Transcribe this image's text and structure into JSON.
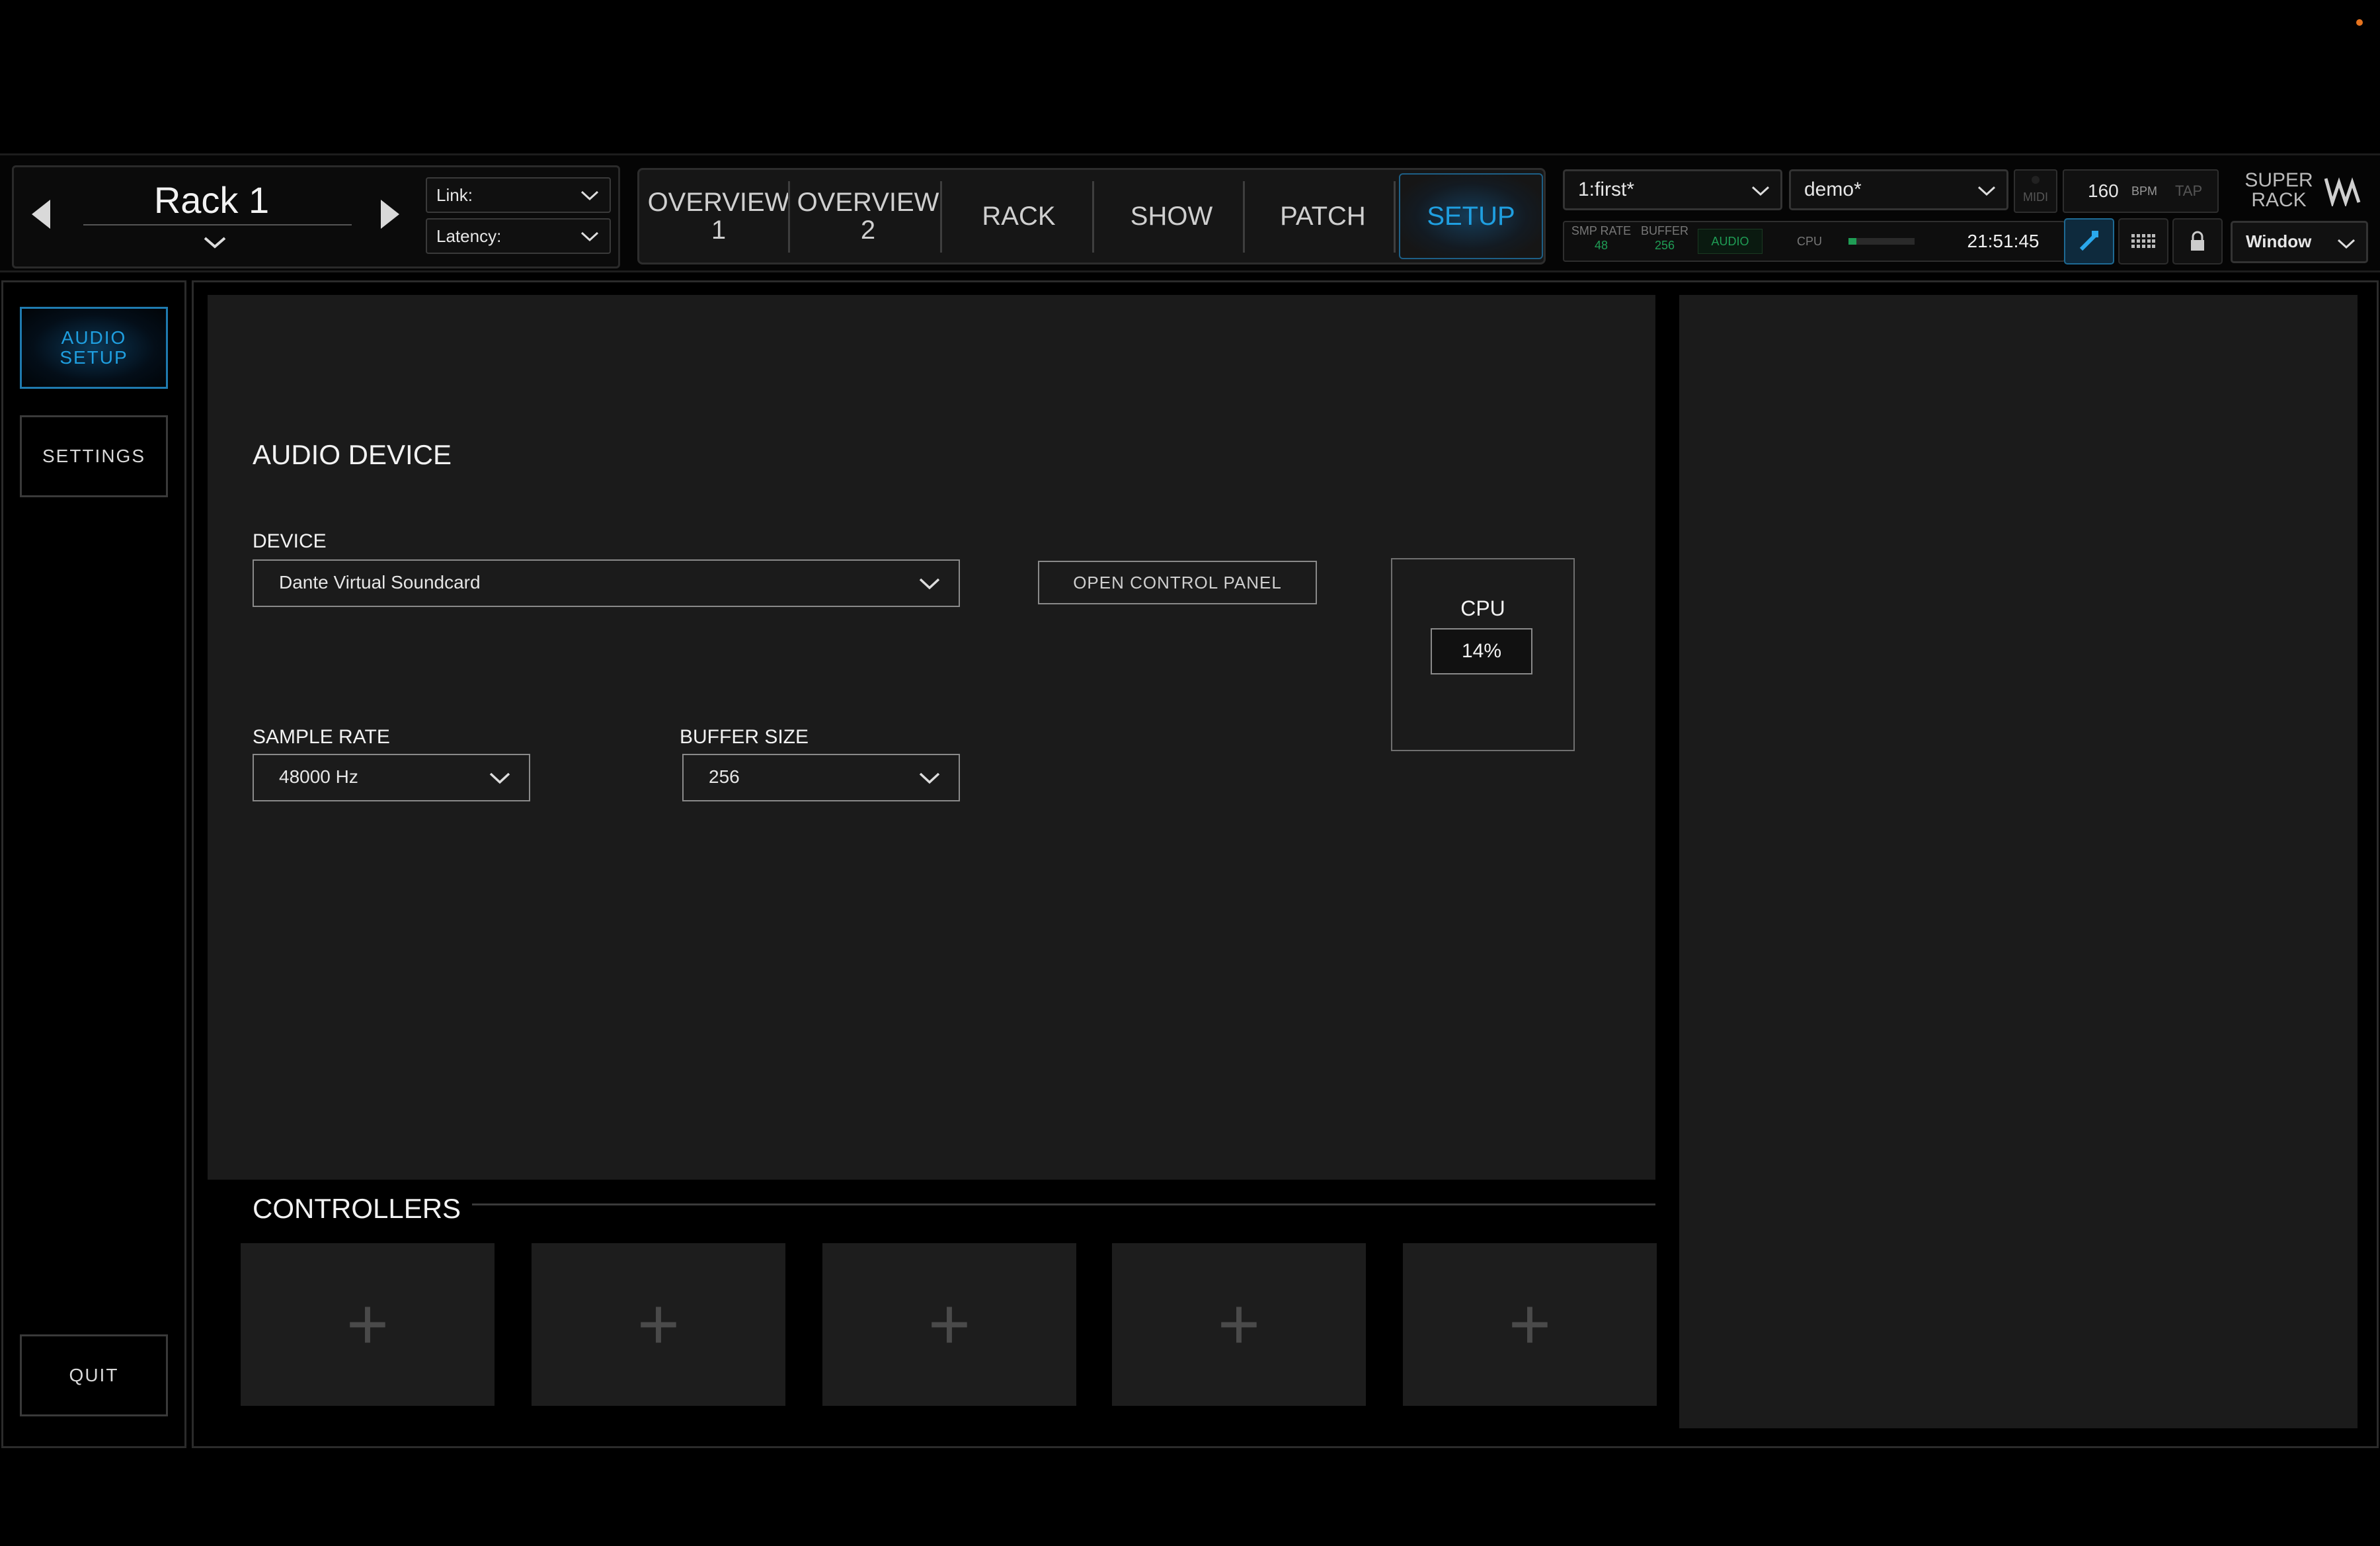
{
  "rack": {
    "name": "Rack 1"
  },
  "link_dropdown": {
    "label": "Link:"
  },
  "latency_dropdown": {
    "label": "Latency:"
  },
  "tabs": [
    {
      "line1": "OVERVIEW",
      "line2": "1"
    },
    {
      "line1": "OVERVIEW",
      "line2": "2"
    },
    {
      "line1": "RACK",
      "line2": ""
    },
    {
      "line1": "SHOW",
      "line2": ""
    },
    {
      "line1": "PATCH",
      "line2": ""
    },
    {
      "line1": "SETUP",
      "line2": ""
    }
  ],
  "status": {
    "snapshot": "1:first*",
    "session": "demo*",
    "midi_label": "MIDI",
    "bpm_value": "160",
    "bpm_label": "BPM",
    "tap_label": "TAP",
    "smp_rate_label": "SMP RATE",
    "smp_rate_value": "48",
    "buffer_label": "BUFFER",
    "buffer_value": "256",
    "audio_label": "AUDIO",
    "cpu_label": "CPU",
    "cpu_meter_level": 0.12,
    "clock": "21:51:45",
    "window_label": "Window"
  },
  "logo": {
    "line1": "SUPER",
    "line2": "RACK"
  },
  "sidebar": {
    "audio_setup_line1": "AUDIO",
    "audio_setup_line2": "SETUP",
    "settings": "SETTINGS",
    "quit": "QUIT"
  },
  "audio_device": {
    "title": "AUDIO DEVICE",
    "device_label": "DEVICE",
    "device_value": "Dante Virtual Soundcard",
    "open_control_panel": "OPEN CONTROL PANEL",
    "cpu_label": "CPU",
    "cpu_value": "14%",
    "sample_rate_label": "SAMPLE RATE",
    "sample_rate_value": "48000 Hz",
    "buffer_size_label": "BUFFER SIZE",
    "buffer_size_value": "256"
  },
  "controllers": {
    "title": "CONTROLLERS",
    "slots": [
      "+",
      "+",
      "+",
      "+",
      "+"
    ]
  },
  "colors": {
    "accent": "#1f9fe0",
    "status_green": "#1f9d55",
    "notification": "#e6731e"
  }
}
